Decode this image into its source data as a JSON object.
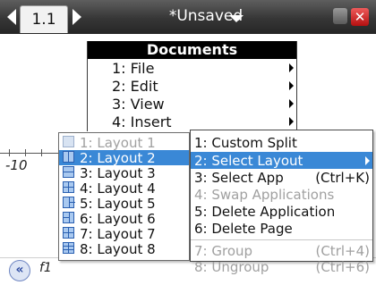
{
  "titlebar": {
    "tab_label": "1.1",
    "doc_title": "*Unsaved"
  },
  "graph": {
    "x_label": "-10",
    "function_label": "f1"
  },
  "documents_menu": {
    "header": "Documents",
    "items": [
      {
        "label": "1: File"
      },
      {
        "label": "2: Edit"
      },
      {
        "label": "3: View"
      },
      {
        "label": "4: Insert"
      }
    ]
  },
  "layout_menu": {
    "items": [
      {
        "label": "1: Layout 1",
        "state": "disabled"
      },
      {
        "label": "2: Layout 2",
        "state": "selected"
      },
      {
        "label": "3: Layout 3",
        "state": "normal"
      },
      {
        "label": "4: Layout 4",
        "state": "normal"
      },
      {
        "label": "5: Layout 5",
        "state": "normal"
      },
      {
        "label": "6: Layout 6",
        "state": "normal"
      },
      {
        "label": "7: Layout 7",
        "state": "normal"
      },
      {
        "label": "8: Layout 8",
        "state": "normal"
      }
    ]
  },
  "page_menu": {
    "items": [
      {
        "label": "1: Custom Split",
        "shortcut": "",
        "state": "normal"
      },
      {
        "label": "2: Select Layout",
        "shortcut": "",
        "state": "selected"
      },
      {
        "label": "3: Select App",
        "shortcut": "(Ctrl+K)",
        "state": "normal"
      },
      {
        "label": "4: Swap Applications",
        "shortcut": "",
        "state": "disabled"
      },
      {
        "label": "5: Delete Application",
        "shortcut": "",
        "state": "normal"
      },
      {
        "label": "6: Delete Page",
        "shortcut": "",
        "state": "normal"
      },
      {
        "label": "7: Group",
        "shortcut": "(Ctrl+4)",
        "state": "disabled"
      },
      {
        "label": "8: Ungroup",
        "shortcut": "(Ctrl+6)",
        "state": "disabled"
      }
    ]
  },
  "colors": {
    "selection": "#3a88d6",
    "titlebar": "#363636",
    "close": "#d62828"
  }
}
